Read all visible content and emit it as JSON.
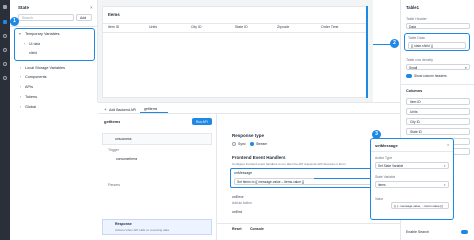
{
  "state_panel": {
    "title": "State",
    "search_placeholder": "Search",
    "add_label": "Add",
    "items": [
      "Temporary Variables",
      "UI data",
      "sfield",
      "Local Storage Variables",
      "Components",
      "APIs",
      "Tokens",
      "Global"
    ]
  },
  "canvas": {
    "table_title": "Items",
    "columns": [
      "Item ID",
      "Units",
      "City ID",
      "State ID",
      "Zipcode",
      "Order Time"
    ]
  },
  "right_panel": {
    "title": "Table1",
    "table_header_label": "Table Header",
    "header_value": "Data",
    "table_data_label": "Table Data",
    "table_data_value": "{{ state.sfield }}",
    "row_density_label": "Table row density",
    "row_density_value": "Small",
    "show_headers_label": "Show column headers",
    "columns_label": "Columns",
    "column_items": [
      "Item ID",
      "Units",
      "City ID",
      "State ID",
      "Zipcode",
      "Order Time"
    ],
    "enable_search_label": "Enable Search"
  },
  "bottom_panel": {
    "add_api_label": "Add Backend API",
    "tab_label": "getItems",
    "api_name": "getItems",
    "run_label": "Run API",
    "trigger_label": "Trigger",
    "trigger_name": "onsuccess",
    "trigger_sub": "consumeItems",
    "params_label": "Parsers",
    "response_label": "Response",
    "response_sub": "Actions when API calls on receiving data",
    "response_type_title": "Response type",
    "sync_label": "Sync",
    "stream_label": "Stream",
    "frontend_title": "Frontend Event Handlers",
    "frontend_sub": "Configure frontend event handlers to run after the API responds with Success or Error",
    "onmessage_label": "onMessage",
    "set_items_value": "Set items to {{ message.value – items.value }}",
    "onerror_label": "onError",
    "onerror_sub": "Add an Action",
    "onend_label": "onEnd",
    "reset_label": "Reset",
    "console_label": "Console"
  },
  "popup": {
    "title": "setMessage",
    "action_type_label": "Action Type",
    "action_type_value": "Set State Variable",
    "state_variable_label": "State Variable",
    "state_variable_value": "items",
    "value_label": "Value",
    "value_value": "{{ [...message.value, ...items.value] }}"
  },
  "badges": [
    "1",
    "2",
    "3"
  ],
  "colors": {
    "accent": "#1e88e5",
    "sidebar": "#2b2f3a"
  }
}
